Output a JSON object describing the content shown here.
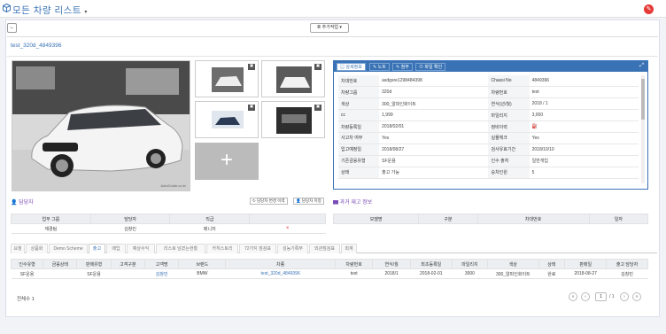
{
  "header": {
    "title": "모든 차량 리스트",
    "title_caret": "▾"
  },
  "toolbar": {
    "back_label": "←",
    "action_label": "≣ 추가작업 ▾"
  },
  "vehicle": {
    "name": "test_320d_4849396"
  },
  "photos": {
    "watermark": "AutoGuide.co.kr",
    "close_glyph": "✖",
    "add_glyph": "+"
  },
  "info_tabs": [
    "상세정보",
    "노트",
    "첨부",
    "파일 확인"
  ],
  "info_rows": [
    {
      "k1": "차대번호",
      "v1": "asdgsre1298484398",
      "k2": "Chassi No",
      "v2": "4849396"
    },
    {
      "k1": "차량그룹",
      "v1": "320d",
      "k2": "차량번호",
      "v2": "test"
    },
    {
      "k1": "색상",
      "v1": "300_알파인화이트",
      "k2": "연식(년/월)",
      "v2": "2018 / 1"
    },
    {
      "k1": "cc",
      "v1": "1,999",
      "k2": "마일리지",
      "v2": "3,000"
    },
    {
      "k1": "차량등록일",
      "v1": "2018/02/01",
      "k2": "정비이력",
      "v2": "⛽"
    },
    {
      "k1": "사고차 여부",
      "v1": "Yes",
      "k2": "실물체크",
      "v2": "Yes"
    },
    {
      "k1": "입고예정일",
      "v1": "2018/08/27",
      "k2": "검사유효기간",
      "v2": "2018/10/10"
    },
    {
      "k1": "기존금융유형",
      "v1": "SF운용",
      "k2": "인수 출처",
      "v2": "일반개입"
    },
    {
      "k1": "상태",
      "v1": "출고 가능",
      "k2": "승차인원",
      "v2": "5"
    }
  ],
  "manager": {
    "title": "담당자",
    "btn_change": "담당자 변경 이력",
    "btn_assign": "담당자 지정",
    "columns": [
      "업무 그룹",
      "담당자",
      "직급",
      ""
    ],
    "row": [
      "재경팀",
      "김창민",
      "매니저",
      "×"
    ]
  },
  "past": {
    "title": "과거 재고 정보",
    "columns": [
      "모델명",
      "구분",
      "차대번호",
      "일자"
    ]
  },
  "bottom_tabs": [
    "요청",
    "상품화",
    "Demo Scheme",
    "출고",
    "매입",
    "예상수익",
    "리스로 넘겼는현황",
    "카히스토리",
    "72가지 점검표",
    "성능기록부",
    "외관점검표",
    "회계"
  ],
  "sales": {
    "columns": [
      "인수유형",
      "금융상태",
      "판매유형",
      "고객구분",
      "고객명",
      "브랜드",
      "차종",
      "차량번호",
      "연식/월",
      "최초등록일",
      "마일리지",
      "색상",
      "상태",
      "판매일",
      "출고 담당자"
    ],
    "row": [
      "SF운용",
      "",
      "SF운용",
      "",
      "김창민",
      "BMW",
      "test_320d_4849396",
      "test",
      "2018/1",
      "2018-02-01",
      "3000",
      "300_알파인화이트",
      "완료",
      "2018-08-27",
      "김창민"
    ]
  },
  "footer": {
    "total": "전체수 1",
    "page_current": "1",
    "page_total": "/ 1"
  }
}
